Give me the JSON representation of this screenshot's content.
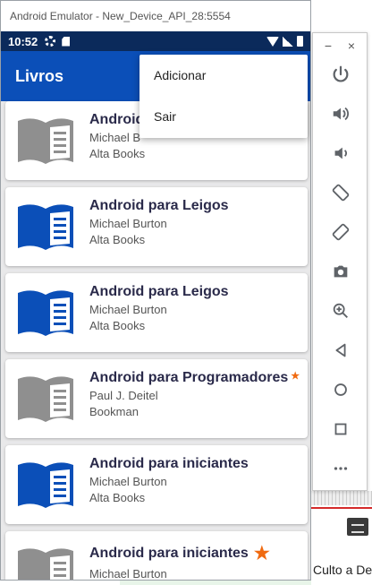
{
  "window": {
    "title": "Android Emulator - New_Device_API_28:5554"
  },
  "status_bar": {
    "time": "10:52"
  },
  "app_bar": {
    "title": "Livros"
  },
  "overflow_menu": {
    "items": [
      "Adicionar",
      "Sair"
    ]
  },
  "books": [
    {
      "title": "Android",
      "author": "Michael B",
      "publisher": "Alta Books",
      "icon_color": "#8f8f8f",
      "star": "none"
    },
    {
      "title": "Android para Leigos",
      "author": "Michael Burton",
      "publisher": "Alta Books",
      "icon_color": "#0b4fb8",
      "star": "none"
    },
    {
      "title": "Android para Leigos",
      "author": "Michael Burton",
      "publisher": "Alta Books",
      "icon_color": "#0b4fb8",
      "star": "none"
    },
    {
      "title": "Android para Programadores",
      "author": "Paul J. Deitel",
      "publisher": "Bookman",
      "icon_color": "#8f8f8f",
      "star": "small"
    },
    {
      "title": "Android para iniciantes",
      "author": "Michael Burton",
      "publisher": "Alta Books",
      "icon_color": "#0b4fb8",
      "star": "none"
    },
    {
      "title": "Android para iniciantes",
      "author": "Michael Burton",
      "publisher": "Alta Books",
      "icon_color": "#8f8f8f",
      "star": "big"
    }
  ],
  "toolbar": {
    "minimize": "−",
    "close": "×",
    "buttons": [
      "power-icon",
      "volume-up-icon",
      "volume-down-icon",
      "rotate-left-icon",
      "rotate-right-icon",
      "camera-icon",
      "zoom-icon",
      "back-icon",
      "home-icon",
      "overview-icon",
      "more-icon"
    ]
  },
  "background": {
    "text": "Culto a Deu"
  },
  "colors": {
    "primary": "#0b4fb8",
    "primary_dark": "#0b2a5b",
    "accent_star": "#f06a10",
    "icon_gray": "#8f8f8f"
  }
}
